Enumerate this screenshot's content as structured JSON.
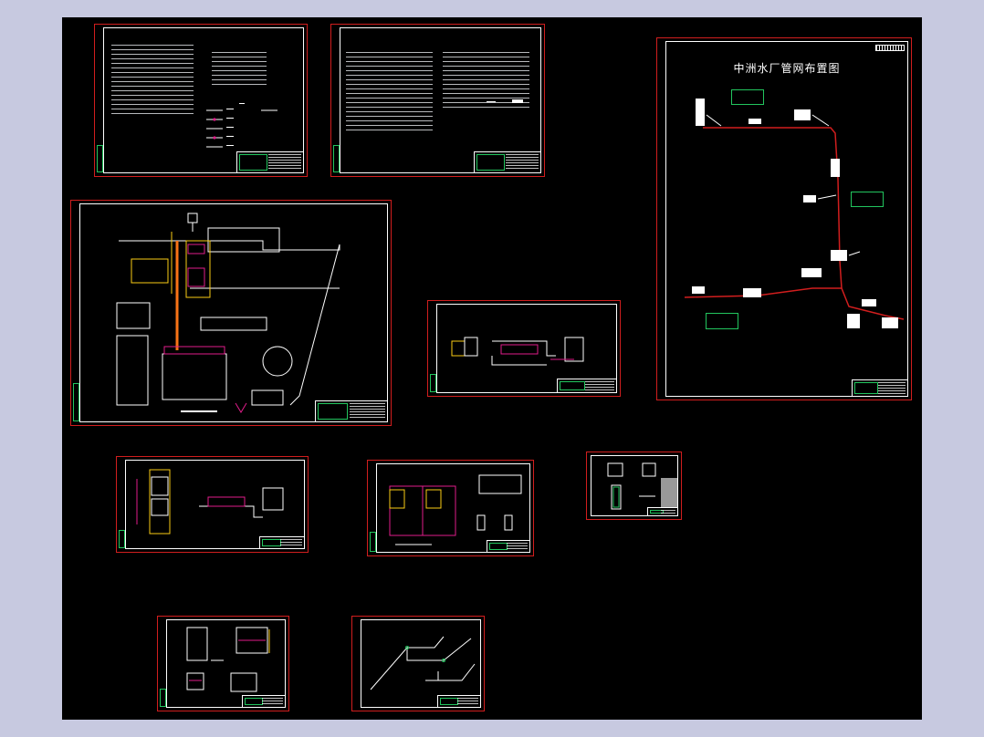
{
  "app": {
    "background_color": "#c7c9e0",
    "canvas_color": "#000000",
    "sheet_border_color": "#d11e1e",
    "line_color": "#ffffff",
    "accent_green": "#22c55e",
    "accent_yellow": "#facc15",
    "accent_magenta": "#e11d8a",
    "accent_orange": "#f97316"
  },
  "sheets": {
    "network_layout": {
      "title": "中洲水厂管网布置图"
    },
    "design_notes": {
      "title": ""
    },
    "legend_notes": {
      "title": ""
    },
    "site_plan": {
      "title": ""
    }
  }
}
